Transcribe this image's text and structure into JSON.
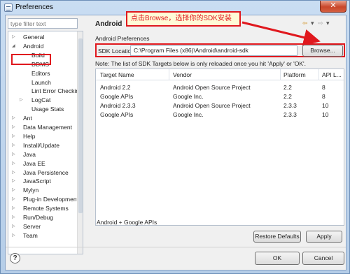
{
  "window": {
    "title": "Preferences",
    "close_glyph": "✕"
  },
  "filter": {
    "placeholder": "type filter text"
  },
  "tree": {
    "items": [
      {
        "label": "General",
        "arrow": "▷"
      },
      {
        "label": "Android",
        "arrow": "◢"
      },
      {
        "label": "Build",
        "arrow": ""
      },
      {
        "label": "DDMS",
        "arrow": ""
      },
      {
        "label": "Editors",
        "arrow": ""
      },
      {
        "label": "Launch",
        "arrow": ""
      },
      {
        "label": "Lint Error Checking",
        "arrow": ""
      },
      {
        "label": "LogCat",
        "arrow": "▷"
      },
      {
        "label": "Usage Stats",
        "arrow": ""
      },
      {
        "label": "Ant",
        "arrow": "▷"
      },
      {
        "label": "Data Management",
        "arrow": "▷"
      },
      {
        "label": "Help",
        "arrow": "▷"
      },
      {
        "label": "Install/Update",
        "arrow": "▷"
      },
      {
        "label": "Java",
        "arrow": "▷"
      },
      {
        "label": "Java EE",
        "arrow": "▷"
      },
      {
        "label": "Java Persistence",
        "arrow": "▷"
      },
      {
        "label": "JavaScript",
        "arrow": "▷"
      },
      {
        "label": "Mylyn",
        "arrow": "▷"
      },
      {
        "label": "Plug-in Development",
        "arrow": "▷"
      },
      {
        "label": "Remote Systems",
        "arrow": "▷"
      },
      {
        "label": "Run/Debug",
        "arrow": "▷"
      },
      {
        "label": "Server",
        "arrow": "▷"
      },
      {
        "label": "Team",
        "arrow": "▷"
      }
    ]
  },
  "main": {
    "section_title": "Android",
    "callout": "点击Browse，选择你的SDK安装",
    "preferences_label": "Android Preferences",
    "sdk_location_label": "SDK Location:",
    "sdk_location_value": "C:\\Program Files (x86)\\Android\\android-sdk",
    "browse_label": "Browse...",
    "note": "Note: The list of SDK Targets below is only reloaded once you hit 'Apply' or 'OK'.",
    "table": {
      "columns": [
        "Target Name",
        "Vendor",
        "Platform",
        "API L..."
      ],
      "rows": [
        [
          "Android 2.2",
          "Android Open Source Project",
          "2.2",
          "8"
        ],
        [
          "Google APIs",
          "Google Inc.",
          "2.2",
          "8"
        ],
        [
          "Android 2.3.3",
          "Android Open Source Project",
          "2.3.3",
          "10"
        ],
        [
          "Google APIs",
          "Google Inc.",
          "2.3.3",
          "10"
        ]
      ]
    },
    "footer_label": "Android + Google APIs",
    "restore_label": "Restore Defaults",
    "apply_label": "Apply"
  },
  "bottom": {
    "help_glyph": "?",
    "ok_label": "OK",
    "cancel_label": "Cancel"
  },
  "nav": {
    "back": "⇦",
    "back_menu": "▾",
    "forward": "⇨",
    "forward_menu": "▾"
  },
  "colors": {
    "annotation_red": "#e0181e"
  }
}
